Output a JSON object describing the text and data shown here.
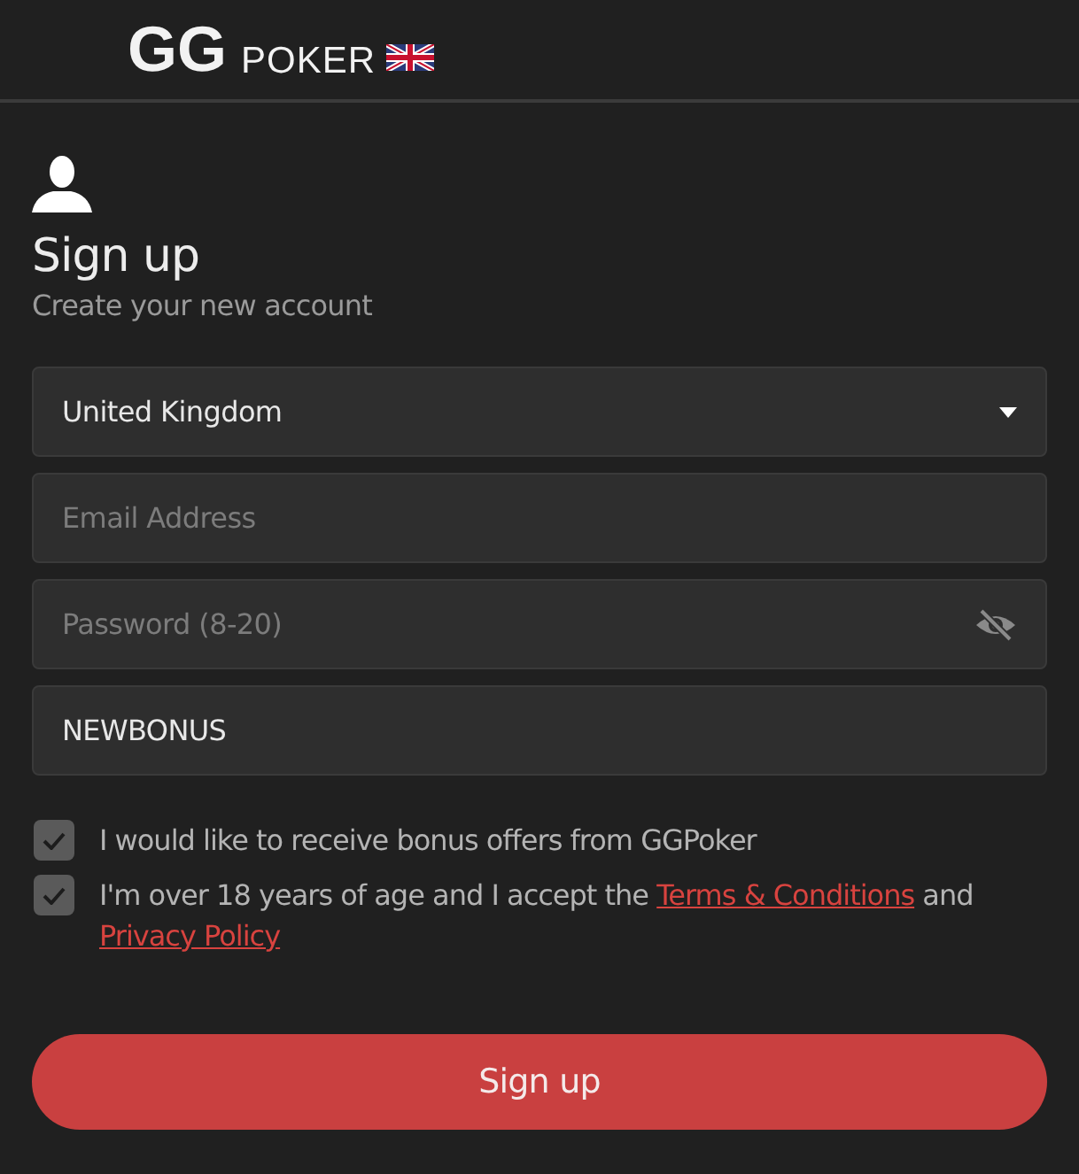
{
  "header": {
    "logo_mark": "GG",
    "logo_word": "POKER"
  },
  "title": "Sign up",
  "subtitle": "Create your new account",
  "fields": [
    {
      "kind": "select",
      "value": "United Kingdom"
    },
    {
      "kind": "input",
      "placeholder": "Email Address"
    },
    {
      "kind": "password",
      "placeholder": "Password (8-20)"
    },
    {
      "kind": "input",
      "value": "NEWBONUS"
    }
  ],
  "checkboxes": [
    {
      "checked": true,
      "parts": [
        {
          "kind": "text",
          "text": "I would like to receive bonus offers from GGPoker"
        }
      ]
    },
    {
      "checked": true,
      "parts": [
        {
          "kind": "text",
          "text": "I'm over 18 years of age and I accept the "
        },
        {
          "kind": "link",
          "text": "Terms & Conditions"
        },
        {
          "kind": "text",
          "text": " and "
        },
        {
          "kind": "link",
          "text": "Privacy Policy"
        }
      ]
    }
  ],
  "submit": "Sign up"
}
